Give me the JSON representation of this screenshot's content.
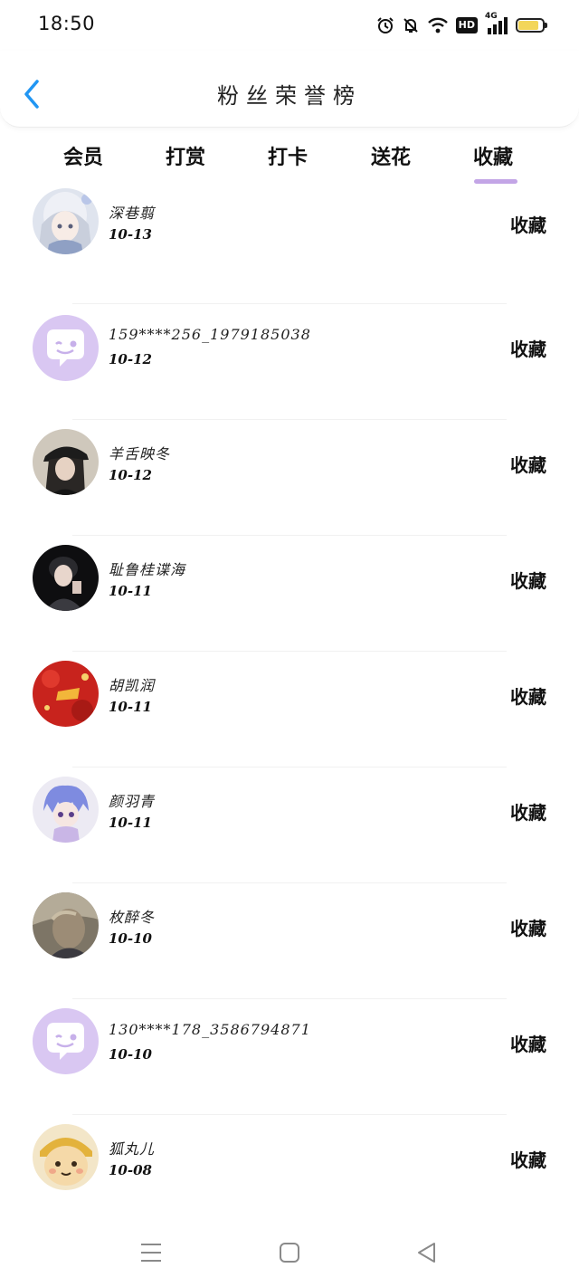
{
  "status_bar": {
    "time": "18:50",
    "icons": [
      "alarm-icon",
      "bell-muted-icon",
      "wifi-icon",
      "hd-icon",
      "signal-4g-icon",
      "battery-icon"
    ],
    "hd_label": "HD",
    "network_label": "4G",
    "battery_level": 0.85,
    "battery_color": "#f3d65a"
  },
  "header": {
    "title": "粉丝荣誉榜",
    "back_icon": "chevron-left-icon",
    "accent_color": "#2196f3"
  },
  "tabs": {
    "items": [
      {
        "label": "会员"
      },
      {
        "label": "打赏"
      },
      {
        "label": "打卡"
      },
      {
        "label": "送花"
      },
      {
        "label": "收藏"
      }
    ],
    "active_index": 4,
    "indicator_color": "#c3a5e6"
  },
  "list": {
    "rows": [
      {
        "name": "深巷翦",
        "date": "10-13",
        "action": "收藏",
        "avatar": "anime-girl-avatar"
      },
      {
        "name": "159****256_1979185038",
        "date": "10-12",
        "action": "收藏",
        "avatar": "default-chat-avatar"
      },
      {
        "name": "羊舌映冬",
        "date": "10-12",
        "action": "收藏",
        "avatar": "photo-avatar"
      },
      {
        "name": "耻鲁桂谍海",
        "date": "10-11",
        "action": "收藏",
        "avatar": "photo-avatar"
      },
      {
        "name": "胡凯润",
        "date": "10-11",
        "action": "收藏",
        "avatar": "red-pattern-avatar"
      },
      {
        "name": "颜羽青",
        "date": "10-11",
        "action": "收藏",
        "avatar": "anime-chibi-avatar"
      },
      {
        "name": "枚醉冬",
        "date": "10-10",
        "action": "收藏",
        "avatar": "photo-avatar"
      },
      {
        "name": "130****178_3586794871",
        "date": "10-10",
        "action": "收藏",
        "avatar": "default-chat-avatar"
      },
      {
        "name": "狐丸儿",
        "date": "10-08",
        "action": "收藏",
        "avatar": "cartoon-face-avatar"
      }
    ]
  },
  "nav_bar": {
    "icons": [
      "menu-icon",
      "home-square-icon",
      "back-triangle-icon"
    ]
  }
}
